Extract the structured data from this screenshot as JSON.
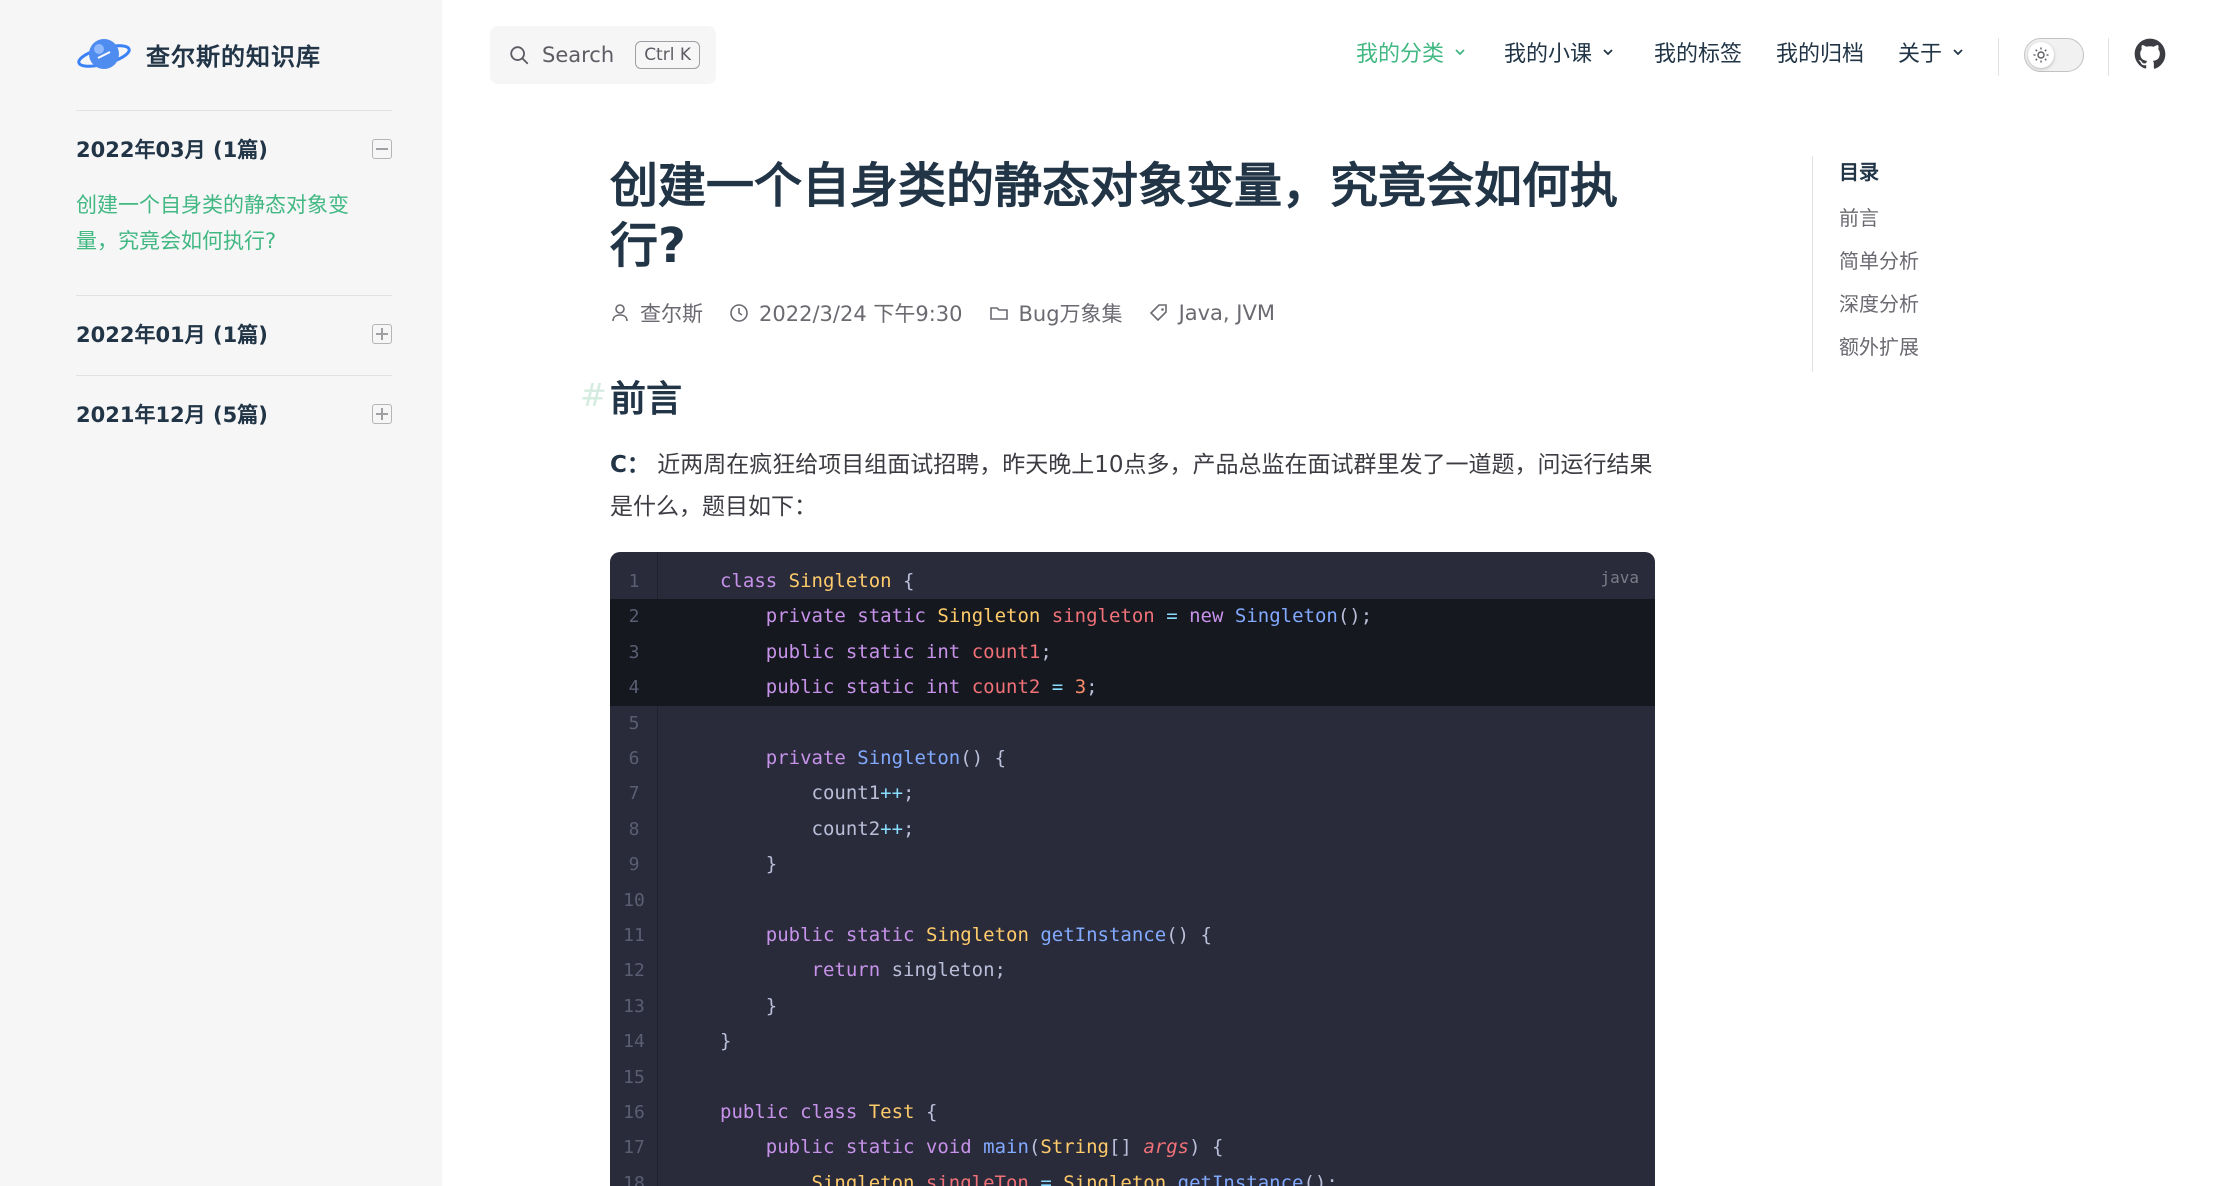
{
  "site": {
    "title": "查尔斯的知识库"
  },
  "sidebar": {
    "groups": [
      {
        "title": "2022年03月 (1篇)",
        "expanded": true,
        "links": [
          "创建一个自身类的静态对象变量，究竟会如何执行?"
        ]
      },
      {
        "title": "2022年01月 (1篇)",
        "expanded": false,
        "links": []
      },
      {
        "title": "2021年12月 (5篇)",
        "expanded": false,
        "links": []
      }
    ]
  },
  "search": {
    "label": "Search",
    "shortcut": "Ctrl K"
  },
  "nav": {
    "items": [
      {
        "label": "我的分类",
        "dropdown": true,
        "active": true
      },
      {
        "label": "我的小课",
        "dropdown": true,
        "active": false
      },
      {
        "label": "我的标签",
        "dropdown": false,
        "active": false
      },
      {
        "label": "我的归档",
        "dropdown": false,
        "active": false
      },
      {
        "label": "关于",
        "dropdown": true,
        "active": false
      }
    ]
  },
  "article": {
    "title": "创建一个自身类的静态对象变量，究竟会如何执行?",
    "meta": {
      "author": "查尔斯",
      "date": "2022/3/24 下午9:30",
      "category": "Bug万象集",
      "tags": "Java, JVM"
    },
    "h2": "前言",
    "para_prefix": "C：",
    "para_text": " 近两周在疯狂给项目组面试招聘，昨天晚上10点多，产品总监在面试群里发了一道题，问运行结果是什么，题目如下："
  },
  "code": {
    "lang": "java",
    "lines": [
      "1",
      "2",
      "3",
      "4",
      "5",
      "6",
      "7",
      "8",
      "9",
      "10",
      "11",
      "12",
      "13",
      "14",
      "15",
      "16",
      "17",
      "18"
    ]
  },
  "toc": {
    "title": "目录",
    "items": [
      "前言",
      "简单分析",
      "深度分析",
      "额外扩展"
    ]
  },
  "colors": {
    "accent": "#42b883",
    "code_bg": "#292b3a",
    "sidebar_bg": "#f6f6f7"
  }
}
